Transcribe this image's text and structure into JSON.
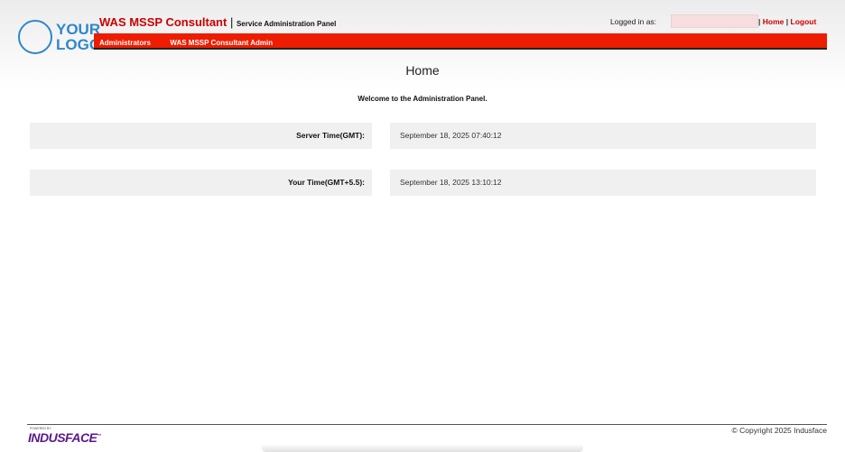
{
  "logo": {
    "line1": "YOUR",
    "line2": "LOGO"
  },
  "header": {
    "brand_name": "WAS MSSP Consultant",
    "separator": "|",
    "subtitle": "Service Administration Panel",
    "logged_in_label": "Logged in as:",
    "logged_in_user": "",
    "home_link": "Home",
    "logout_link": "Logout",
    "link_separator": "|"
  },
  "nav": {
    "items": [
      {
        "label": "Administrators"
      },
      {
        "label": "WAS MSSP Consultant Admin"
      }
    ]
  },
  "main": {
    "title": "Home",
    "welcome": "Welcome to the Administration Panel.",
    "rows": [
      {
        "label": "Server Time(GMT):",
        "value": "September 18, 2025 07:40:12"
      },
      {
        "label": "Your Time(GMT+5.5):",
        "value": "September 18, 2025 13:10:12"
      }
    ]
  },
  "footer": {
    "powered_by": "POWERED BY",
    "brand": "INDUSFACE",
    "trademark": "™",
    "copyright": "© Copyright 2025 Indusface"
  },
  "colors": {
    "accent": "#cc0000",
    "nav_bg": "#ee1c00",
    "logo": "#2f87c9",
    "footer_brand": "#5a1a8a"
  }
}
